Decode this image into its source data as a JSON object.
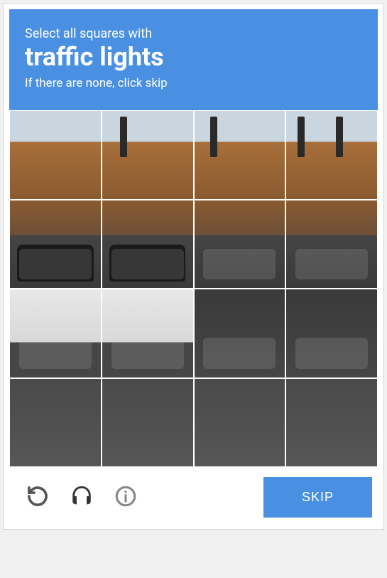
{
  "header": {
    "instruction": "Select all squares with",
    "target": "traffic lights",
    "subtext": "If there are none, click skip"
  },
  "grid": {
    "rows": 4,
    "cols": 4
  },
  "footer": {
    "reload_icon": "reload",
    "audio_icon": "audio",
    "info_icon": "info",
    "skip_label": "SKIP"
  }
}
